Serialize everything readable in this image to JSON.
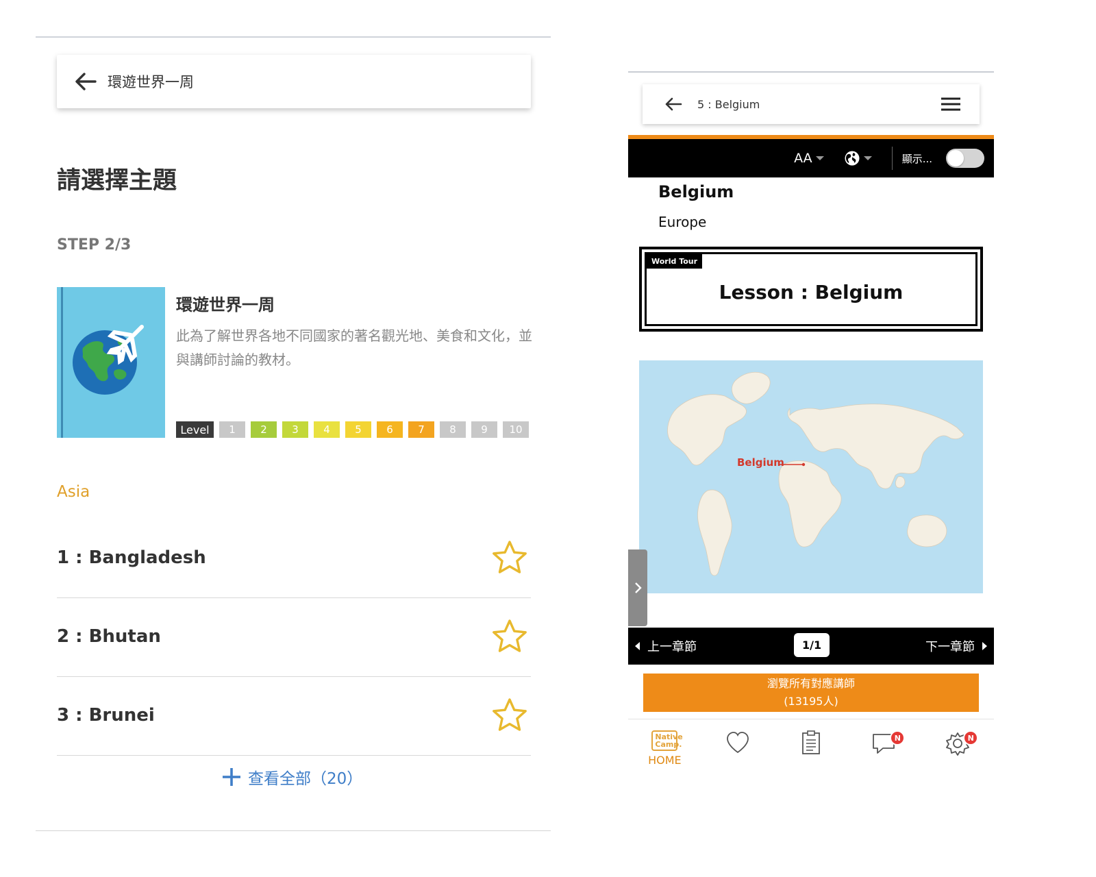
{
  "left_panel": {
    "header": {
      "title": "環遊世界一周"
    },
    "page_title": "請選擇主題",
    "step": "STEP 2/3",
    "course": {
      "title": "環遊世界一周",
      "description": "此為了解世界各地不同國家的著名觀光地、美食和文化，並與講師討論的教材。",
      "level_label": "Level",
      "levels": [
        {
          "label": "1",
          "color": "#c8c8c8"
        },
        {
          "label": "2",
          "color": "#a6cc3c"
        },
        {
          "label": "3",
          "color": "#c3d83a"
        },
        {
          "label": "4",
          "color": "#e9e140"
        },
        {
          "label": "5",
          "color": "#f3d433"
        },
        {
          "label": "6",
          "color": "#f5b520"
        },
        {
          "label": "7",
          "color": "#f3a420"
        },
        {
          "label": "8",
          "color": "#c8c8c8"
        },
        {
          "label": "9",
          "color": "#c8c8c8"
        },
        {
          "label": "10",
          "color": "#c8c8c8"
        }
      ]
    },
    "region": "Asia",
    "topics": [
      {
        "name": "1 : Bangladesh"
      },
      {
        "name": "2 : Bhutan"
      },
      {
        "name": "3 : Brunei"
      }
    ],
    "view_all": "查看全部（20）"
  },
  "right_panel": {
    "header": {
      "title": "5 : Belgium"
    },
    "toolbar": {
      "font_size_label": "AA",
      "display_label": "顯示..."
    },
    "country": "Belgium",
    "continent": "Europe",
    "lesson_card": {
      "tag": "World Tour",
      "title": "Lesson : Belgium"
    },
    "map_label": "Belgium",
    "nav": {
      "prev": "上一章節",
      "page": "1/1",
      "next": "下一章節"
    },
    "tutor_button": {
      "line1": "瀏覽所有對應講師",
      "line2": "(13195人)"
    },
    "tabs": {
      "home_label": "HOME",
      "logo_text": "Native Camp.",
      "badge1": "N",
      "badge2": "N"
    }
  },
  "colors": {
    "accent_orange": "#ee8b18",
    "link_blue": "#3f7ec8",
    "star_yellow": "#e8b92e",
    "region_gold": "#e0a02a"
  }
}
